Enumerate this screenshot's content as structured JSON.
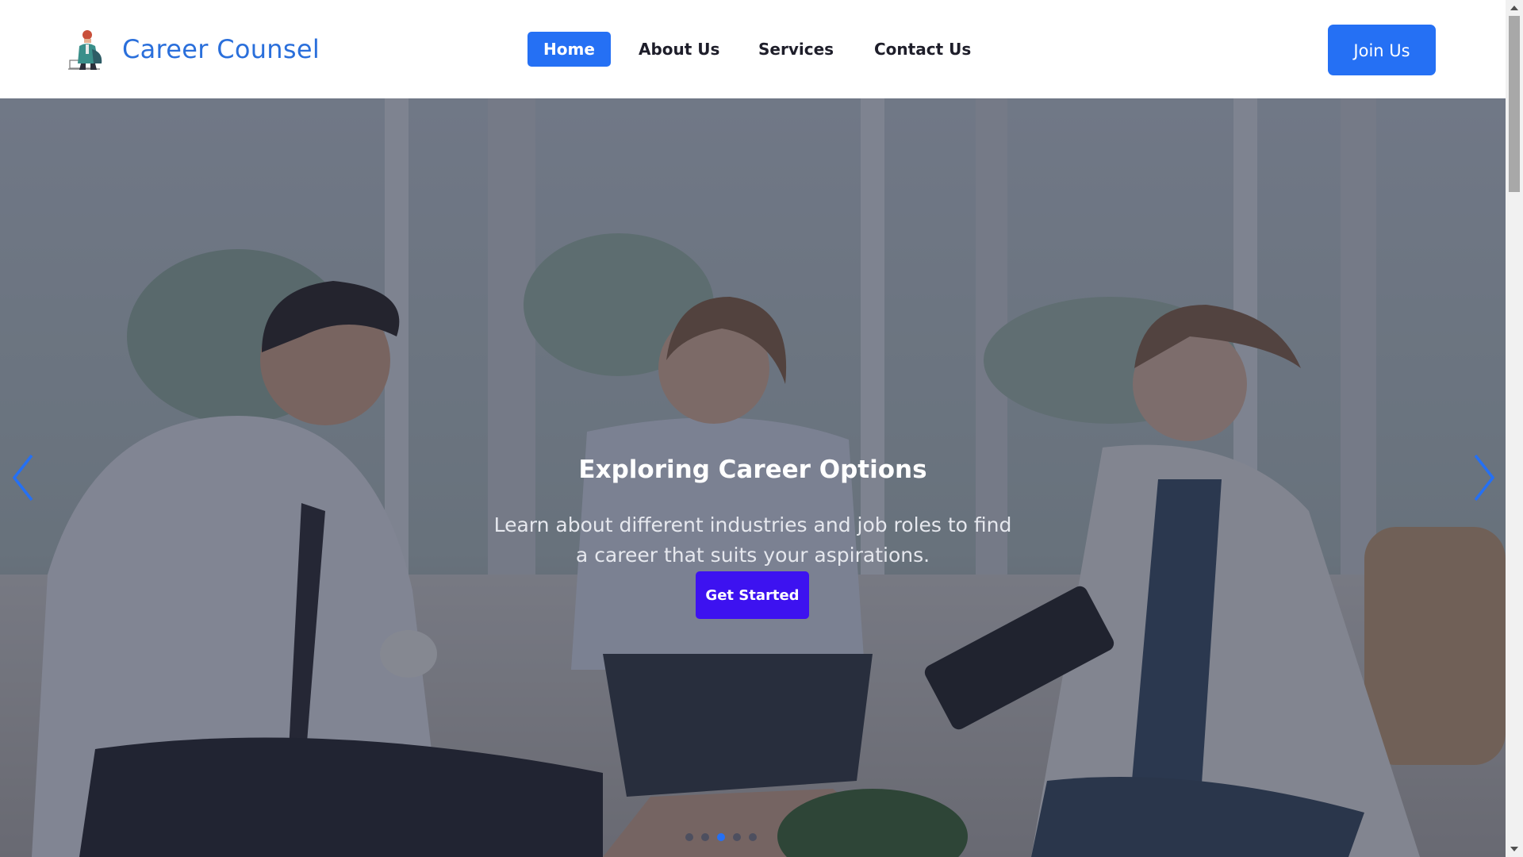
{
  "header": {
    "brand": "Career Counsel",
    "logo_icon": "counselor-illustration-icon",
    "nav": [
      {
        "label": "Home",
        "active": true
      },
      {
        "label": "About Us",
        "active": false
      },
      {
        "label": "Services",
        "active": false
      },
      {
        "label": "Contact Us",
        "active": false
      }
    ],
    "join_label": "Join Us"
  },
  "hero": {
    "title": "Exploring Career Options",
    "text": "Learn about different industries and job roles to find a career that suits your aspirations.",
    "cta_label": "Get Started",
    "prev_icon": "chevron-left-icon",
    "next_icon": "chevron-right-icon",
    "slides_count": 5,
    "active_slide": 3
  },
  "colors": {
    "accent": "#2570f4",
    "cta": "#3d12f0",
    "brand_text": "#2a6fdb",
    "nav_text": "#1e1e2a"
  }
}
